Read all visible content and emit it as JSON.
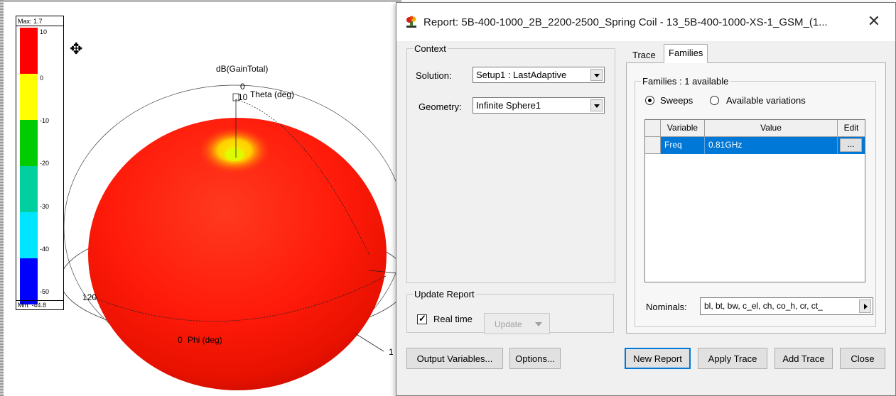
{
  "plot": {
    "legend": {
      "max_label": "Max: 1.7",
      "min_label": "Min: -44.8",
      "ticks": [
        "10",
        "0",
        "-10",
        "-20",
        "-30",
        "-40",
        "-50"
      ],
      "colors": [
        "#ff0000",
        "#ffff00",
        "#00cc00",
        "#00d0a0",
        "#00e5ff",
        "#0000ff"
      ]
    },
    "quantity_label": "dB(GainTotal)",
    "theta_zero": "0",
    "theta_ten": "10",
    "theta_axis": "Theta (deg)",
    "phi_zero": "0",
    "phi_axis": "Phi (deg)",
    "angle_120": "120",
    "angle_partial": "1",
    "sphere_color": "#ff1a0a"
  },
  "dialog": {
    "title": "Report: 5B-400-1000_2B_2200-2500_Spring Coil - 13_5B-400-1000-XS-1_GSM_(1...",
    "close_glyph": "✕",
    "context": {
      "title": "Context",
      "solution_label": "Solution:",
      "solution_value": "Setup1 : LastAdaptive",
      "geometry_label": "Geometry:",
      "geometry_value": "Infinite Sphere1"
    },
    "update_report": {
      "title": "Update Report",
      "realtime_label": "Real time",
      "realtime_checked": true,
      "update_label": "Update"
    },
    "tabs": [
      "Trace",
      "Families"
    ],
    "active_tab": "Families",
    "families": {
      "title": "Families : 1 available",
      "radio_sweeps": "Sweeps",
      "radio_variations": "Available variations",
      "columns": [
        "Variable",
        "Value",
        "Edit"
      ],
      "rows": [
        {
          "variable": "Freq",
          "value": "0.81GHz",
          "edit": "..."
        }
      ]
    },
    "nominals_label": "Nominals:",
    "nominals_value": "bl, bt, bw, c_el, ch, co_h, cr, ct_",
    "buttons": {
      "output_variables": "Output Variables...",
      "options": "Options...",
      "new_report": "New Report",
      "apply_trace": "Apply Trace",
      "add_trace": "Add Trace",
      "close": "Close"
    }
  }
}
